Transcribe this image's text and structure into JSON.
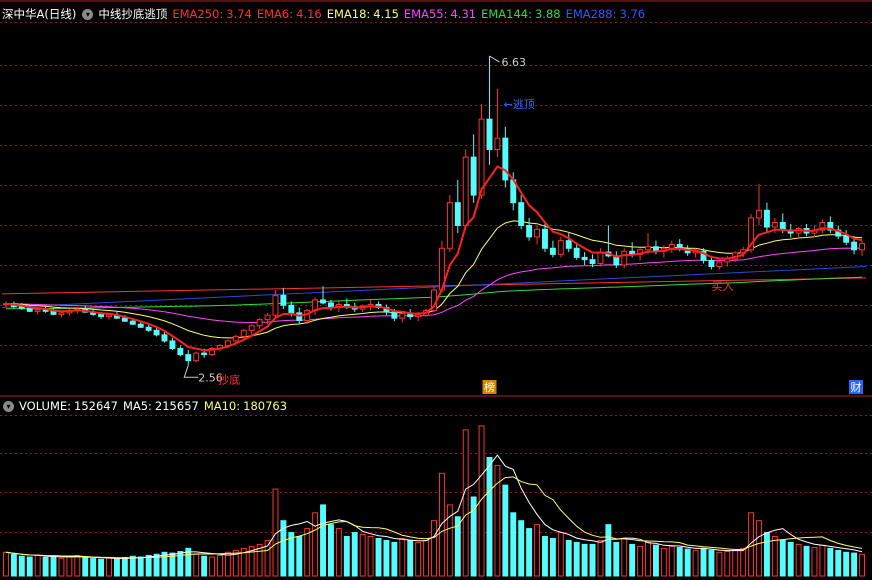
{
  "header": {
    "stock_name": "深中华A(日线)",
    "indicator_name": "中线抄底逃顶",
    "emas": [
      {
        "label": "EMA250:",
        "value": "3.74",
        "color": "#ff3030"
      },
      {
        "label": "EMA6:",
        "value": "4.16",
        "color": "#ff3030"
      },
      {
        "label": "EMA18:",
        "value": "4.15",
        "color": "#ffff66"
      },
      {
        "label": "EMA55:",
        "value": "4.31",
        "color": "#ff44ff"
      },
      {
        "label": "EMA144:",
        "value": "3.88",
        "color": "#33dd33"
      },
      {
        "label": "EMA288:",
        "value": "3.76",
        "color": "#3355ff"
      }
    ]
  },
  "volume_header": {
    "volume_label": "VOLUME:",
    "volume_value": "152647",
    "ma5_label": "MA5:",
    "ma5_value": "215657",
    "ma10_label": "MA10:",
    "ma10_value": "180763"
  },
  "annotations": {
    "high_label": "6.63",
    "low_label": "2.56",
    "escape_label": "逃顶",
    "escape_arrow": "←",
    "bottom_label": "抄底",
    "buy_label": "买入",
    "event_mark_1": "榜",
    "event_mark_2": "财"
  },
  "colors": {
    "up": "#ff3030",
    "down": "#54fcfc",
    "grid": "#8b1a1a",
    "ema6": "#ff2020",
    "ema18": "#ffff66",
    "ema55": "#ff44ff",
    "ema144": "#33dd33",
    "ema288": "#3355ff",
    "ema250": "#ff3030",
    "vol_ma5": "#ffffff",
    "vol_ma10": "#ffff66"
  },
  "chart_data": {
    "type": "candlestick",
    "price_range": [
      2.3,
      7.0
    ],
    "volume_range": [
      0,
      400000
    ],
    "ohlc": [
      [
        3.36,
        3.4,
        3.32,
        3.37
      ],
      [
        3.37,
        3.4,
        3.31,
        3.33
      ],
      [
        3.33,
        3.38,
        3.29,
        3.31
      ],
      [
        3.31,
        3.35,
        3.26,
        3.27
      ],
      [
        3.27,
        3.31,
        3.23,
        3.29
      ],
      [
        3.29,
        3.33,
        3.25,
        3.27
      ],
      [
        3.27,
        3.31,
        3.22,
        3.23
      ],
      [
        3.23,
        3.28,
        3.19,
        3.25
      ],
      [
        3.25,
        3.3,
        3.21,
        3.28
      ],
      [
        3.28,
        3.33,
        3.24,
        3.3
      ],
      [
        3.3,
        3.34,
        3.25,
        3.26
      ],
      [
        3.26,
        3.3,
        3.21,
        3.23
      ],
      [
        3.23,
        3.26,
        3.17,
        3.2
      ],
      [
        3.2,
        3.24,
        3.16,
        3.22
      ],
      [
        3.22,
        3.26,
        3.17,
        3.18
      ],
      [
        3.18,
        3.22,
        3.13,
        3.14
      ],
      [
        3.14,
        3.18,
        3.09,
        3.1
      ],
      [
        3.1,
        3.14,
        3.05,
        3.06
      ],
      [
        3.06,
        3.1,
        3.0,
        3.02
      ],
      [
        3.02,
        3.08,
        2.94,
        2.96
      ],
      [
        2.96,
        3.0,
        2.86,
        2.88
      ],
      [
        2.88,
        2.92,
        2.76,
        2.78
      ],
      [
        2.78,
        2.82,
        2.68,
        2.7
      ],
      [
        2.7,
        2.76,
        2.56,
        2.62
      ],
      [
        2.62,
        2.74,
        2.6,
        2.72
      ],
      [
        2.72,
        2.78,
        2.66,
        2.7
      ],
      [
        2.7,
        2.8,
        2.68,
        2.78
      ],
      [
        2.78,
        2.84,
        2.74,
        2.82
      ],
      [
        2.82,
        2.9,
        2.78,
        2.88
      ],
      [
        2.88,
        2.96,
        2.84,
        2.94
      ],
      [
        2.94,
        3.04,
        2.9,
        3.02
      ],
      [
        3.02,
        3.1,
        2.96,
        3.08
      ],
      [
        3.08,
        3.18,
        3.04,
        3.16
      ],
      [
        3.16,
        3.25,
        3.1,
        3.22
      ],
      [
        3.22,
        3.55,
        3.18,
        3.48
      ],
      [
        3.48,
        3.58,
        3.3,
        3.35
      ],
      [
        3.35,
        3.4,
        3.2,
        3.25
      ],
      [
        3.25,
        3.32,
        3.1,
        3.15
      ],
      [
        3.15,
        3.3,
        3.1,
        3.28
      ],
      [
        3.28,
        3.45,
        3.22,
        3.42
      ],
      [
        3.42,
        3.6,
        3.36,
        3.38
      ],
      [
        3.38,
        3.42,
        3.28,
        3.32
      ],
      [
        3.32,
        3.4,
        3.26,
        3.36
      ],
      [
        3.36,
        3.44,
        3.3,
        3.33
      ],
      [
        3.33,
        3.38,
        3.26,
        3.3
      ],
      [
        3.3,
        3.36,
        3.26,
        3.34
      ],
      [
        3.34,
        3.42,
        3.28,
        3.36
      ],
      [
        3.36,
        3.4,
        3.3,
        3.32
      ],
      [
        3.32,
        3.36,
        3.22,
        3.26
      ],
      [
        3.26,
        3.3,
        3.14,
        3.18
      ],
      [
        3.18,
        3.26,
        3.12,
        3.24
      ],
      [
        3.24,
        3.3,
        3.16,
        3.2
      ],
      [
        3.2,
        3.26,
        3.14,
        3.22
      ],
      [
        3.22,
        3.3,
        3.2,
        3.28
      ],
      [
        3.28,
        3.6,
        3.26,
        3.55
      ],
      [
        3.55,
        4.2,
        3.52,
        4.1
      ],
      [
        4.1,
        4.8,
        4.05,
        4.7
      ],
      [
        4.7,
        5.0,
        4.3,
        4.4
      ],
      [
        4.4,
        5.4,
        4.35,
        5.3
      ],
      [
        5.3,
        5.6,
        4.7,
        4.8
      ],
      [
        4.8,
        6.0,
        4.75,
        5.8
      ],
      [
        5.8,
        6.63,
        5.2,
        5.4
      ],
      [
        5.4,
        6.2,
        5.3,
        5.55
      ],
      [
        5.55,
        5.7,
        4.9,
        5.0
      ],
      [
        5.0,
        5.1,
        4.6,
        4.7
      ],
      [
        4.7,
        4.8,
        4.35,
        4.4
      ],
      [
        4.4,
        4.5,
        4.2,
        4.25
      ],
      [
        4.25,
        4.4,
        4.15,
        4.35
      ],
      [
        4.35,
        4.45,
        4.05,
        4.1
      ],
      [
        4.1,
        4.2,
        3.98,
        4.02
      ],
      [
        4.02,
        4.25,
        3.98,
        4.2
      ],
      [
        4.2,
        4.3,
        4.05,
        4.1
      ],
      [
        4.1,
        4.16,
        3.95,
        3.98
      ],
      [
        3.98,
        4.05,
        3.88,
        3.95
      ],
      [
        3.95,
        4.02,
        3.85,
        3.9
      ],
      [
        3.9,
        4.1,
        3.86,
        4.05
      ],
      [
        4.05,
        4.4,
        3.98,
        4.0
      ],
      [
        4.0,
        4.06,
        3.84,
        3.88
      ],
      [
        3.88,
        4.1,
        3.84,
        4.06
      ],
      [
        4.06,
        4.18,
        3.98,
        4.02
      ],
      [
        4.02,
        4.1,
        3.94,
        4.08
      ],
      [
        4.08,
        4.3,
        4.02,
        4.12
      ],
      [
        4.12,
        4.2,
        4.02,
        4.06
      ],
      [
        4.06,
        4.14,
        3.98,
        4.1
      ],
      [
        4.1,
        4.2,
        4.04,
        4.15
      ],
      [
        4.15,
        4.22,
        4.06,
        4.09
      ],
      [
        4.09,
        4.14,
        4.0,
        4.04
      ],
      [
        4.04,
        4.1,
        3.98,
        4.06
      ],
      [
        4.06,
        4.1,
        3.9,
        3.94
      ],
      [
        3.94,
        4.0,
        3.82,
        3.86
      ],
      [
        3.86,
        3.96,
        3.82,
        3.92
      ],
      [
        3.92,
        4.0,
        3.86,
        3.96
      ],
      [
        3.96,
        4.06,
        3.92,
        4.04
      ],
      [
        4.04,
        4.12,
        3.98,
        4.08
      ],
      [
        4.08,
        4.55,
        4.04,
        4.5
      ],
      [
        4.5,
        4.95,
        4.4,
        4.6
      ],
      [
        4.6,
        4.7,
        4.3,
        4.38
      ],
      [
        4.38,
        4.5,
        4.3,
        4.44
      ],
      [
        4.44,
        4.56,
        4.3,
        4.34
      ],
      [
        4.34,
        4.42,
        4.24,
        4.3
      ],
      [
        4.3,
        4.38,
        4.22,
        4.36
      ],
      [
        4.36,
        4.42,
        4.26,
        4.3
      ],
      [
        4.3,
        4.4,
        4.24,
        4.34
      ],
      [
        4.34,
        4.48,
        4.3,
        4.44
      ],
      [
        4.44,
        4.52,
        4.3,
        4.34
      ],
      [
        4.34,
        4.4,
        4.22,
        4.26
      ],
      [
        4.26,
        4.34,
        4.14,
        4.18
      ],
      [
        4.18,
        4.26,
        4.02,
        4.08
      ],
      [
        4.08,
        4.2,
        4.0,
        4.16
      ]
    ],
    "volume": [
      60000,
      55000,
      50000,
      48000,
      52000,
      47000,
      50000,
      45000,
      48000,
      52000,
      46000,
      44000,
      42000,
      45000,
      43000,
      47000,
      50000,
      48000,
      52000,
      55000,
      60000,
      58000,
      62000,
      70000,
      55000,
      50000,
      48000,
      52000,
      60000,
      65000,
      70000,
      75000,
      80000,
      90000,
      220000,
      140000,
      110000,
      100000,
      120000,
      160000,
      180000,
      130000,
      120000,
      100000,
      110000,
      105000,
      100000,
      95000,
      90000,
      85000,
      95000,
      90000,
      85000,
      90000,
      140000,
      260000,
      180000,
      150000,
      370000,
      200000,
      380000,
      300000,
      280000,
      230000,
      160000,
      140000,
      120000,
      130000,
      100000,
      95000,
      110000,
      90000,
      85000,
      80000,
      80000,
      90000,
      130000,
      85000,
      95000,
      80000,
      75000,
      85000,
      78000,
      70000,
      75000,
      72000,
      68000,
      65000,
      70000,
      65000,
      60000,
      62000,
      65000,
      70000,
      160000,
      140000,
      110000,
      100000,
      90000,
      85000,
      80000,
      75000,
      72000,
      78000,
      70000,
      65000,
      60000,
      58000,
      55000
    ],
    "ema250_line": [
      3.5,
      3.71
    ],
    "ema288_line": [
      3.32,
      3.86
    ],
    "x_label_marks": [
      "榜",
      "财"
    ]
  }
}
